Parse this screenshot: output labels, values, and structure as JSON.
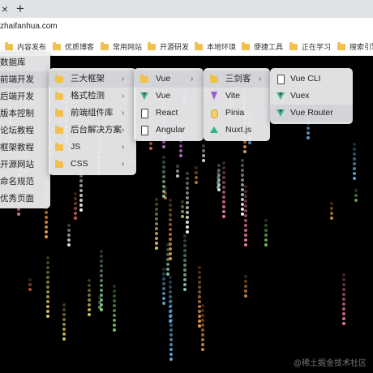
{
  "browser": {
    "tab_close_glyph": "×",
    "new_tab_glyph": "+",
    "url": "zhaifanhua.com"
  },
  "bookmarks": [
    {
      "label": "内容发布"
    },
    {
      "label": "优质博客"
    },
    {
      "label": "常用网站"
    },
    {
      "label": "开源研发"
    },
    {
      "label": "本地环境"
    },
    {
      "label": "便捷工具"
    },
    {
      "label": "正在学习"
    },
    {
      "label": "搜索引擎"
    }
  ],
  "menu_level1": [
    {
      "label": "数据库",
      "has_submenu": true
    },
    {
      "label": "前端开发",
      "has_submenu": true,
      "active": true
    },
    {
      "label": "后端开发",
      "has_submenu": true
    },
    {
      "label": "版本控制",
      "has_submenu": true
    },
    {
      "label": "论坛教程",
      "has_submenu": true
    },
    {
      "label": "框架教程",
      "has_submenu": true
    },
    {
      "label": "开源网站",
      "has_submenu": true
    },
    {
      "label": "命名规范",
      "has_submenu": true
    },
    {
      "label": "优秀页面",
      "has_submenu": true
    }
  ],
  "menu_level2": [
    {
      "label": "三大框架",
      "icon": "folder-icon",
      "has_submenu": true,
      "active": true
    },
    {
      "label": "格式检测",
      "icon": "folder-icon",
      "has_submenu": true
    },
    {
      "label": "前端组件库",
      "icon": "folder-icon",
      "has_submenu": true
    },
    {
      "label": "后台解决方案",
      "icon": "folder-icon",
      "has_submenu": true
    },
    {
      "label": "JS",
      "icon": "folder-icon",
      "has_submenu": true
    },
    {
      "label": "CSS",
      "icon": "folder-icon",
      "has_submenu": true
    }
  ],
  "menu_level3": [
    {
      "label": "Vue",
      "icon": "folder-icon",
      "has_submenu": true,
      "active": true
    },
    {
      "label": "Vue",
      "icon": "vue-icon"
    },
    {
      "label": "React",
      "icon": "page-icon"
    },
    {
      "label": "Angular",
      "icon": "page-icon"
    }
  ],
  "menu_level4": [
    {
      "label": "三剑客",
      "icon": "folder-icon",
      "has_submenu": true,
      "active": true
    },
    {
      "label": "Vite",
      "icon": "vite-icon"
    },
    {
      "label": "Pinia",
      "icon": "pinia-icon"
    },
    {
      "label": "Nuxt.js",
      "icon": "nuxt-icon"
    }
  ],
  "menu_level5": [
    {
      "label": "Vue CLI",
      "icon": "page-icon"
    },
    {
      "label": "Vuex",
      "icon": "vue-icon"
    },
    {
      "label": "Vue Router",
      "icon": "vue-icon",
      "active": true
    }
  ],
  "chevron_glyph": "›",
  "watermark": "@稀土掘金技术社区",
  "colors": {
    "menu_bg": "#ececee",
    "highlight": "#d2d4d8",
    "folder": "#f2c04c",
    "vue_green": "#41b883",
    "canvas_bg": "#000000"
  }
}
